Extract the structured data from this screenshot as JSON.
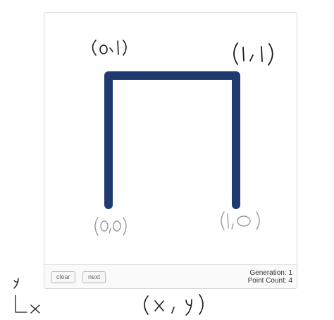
{
  "canvas": {
    "path_color": "#1f3a6e",
    "path_shape": "three connected segments forming an inverted U"
  },
  "controls": {
    "clear_label": "clear",
    "next_label": "next"
  },
  "stats": {
    "generation_label": "Generation: 1",
    "point_count_label": "Point Count: 4"
  },
  "annotations": {
    "handwriting_color": "#1a1a1a",
    "faint_handwriting_color": "#9a9a9a",
    "corner_labels": [
      "(0,1)",
      "(1,1)",
      "(0,0)",
      "(1,0)"
    ],
    "axis_y": "y",
    "axis_x": "x",
    "coord_format": "(x , y)"
  }
}
